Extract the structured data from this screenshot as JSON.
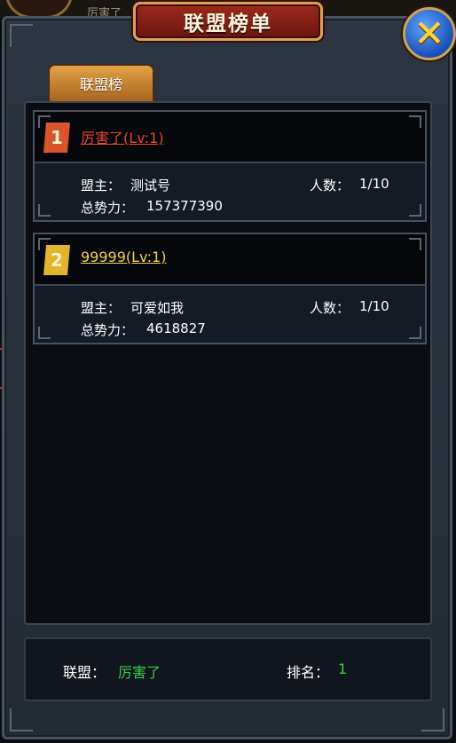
{
  "background": {
    "peek_text": "厉害了"
  },
  "window": {
    "title": "联盟榜单"
  },
  "tabs": [
    {
      "label": "联盟榜"
    }
  ],
  "alliances": [
    {
      "rank": "1",
      "name": "厉害了(Lv:1)",
      "name_color": "#e8452c",
      "badge_color": "#d9542a",
      "leader_label": "盟主：",
      "leader": "测试号",
      "members_label": "人数：",
      "members": "1/10",
      "power_label": "总势力：",
      "power": "157377390"
    },
    {
      "rank": "2",
      "name": "99999(Lv:1)",
      "name_color": "#f5d33a",
      "badge_color": "#e3b52a",
      "leader_label": "盟主：",
      "leader": "可爱如我",
      "members_label": "人数：",
      "members": "1/10",
      "power_label": "总势力：",
      "power": "4618827"
    }
  ],
  "footer": {
    "alliance_label": "联盟：",
    "alliance_value": "厉害了",
    "rank_label": "排名：",
    "rank_value": "1"
  },
  "colors": {
    "highlight_green": "#35d04a",
    "title_red": "#9b2a1c",
    "gold": "#d9a35a"
  }
}
